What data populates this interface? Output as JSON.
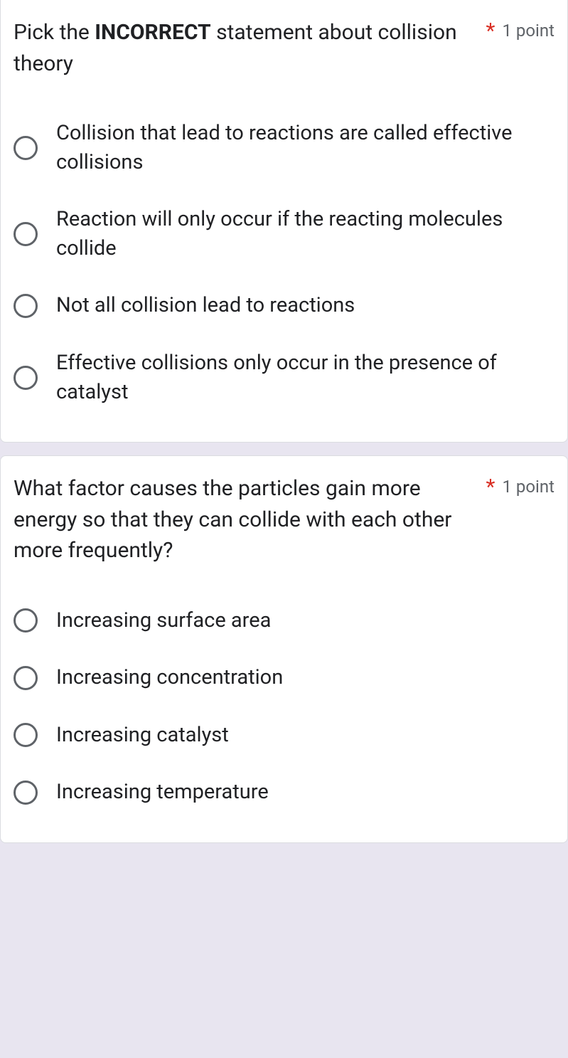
{
  "questions": [
    {
      "title_pre": "Pick the ",
      "title_bold": "INCORRECT",
      "title_post": " statement about collision theory",
      "required_mark": "*",
      "points": "1 point",
      "options": [
        "Collision that lead to reactions are called effective collisions",
        "Reaction will only occur if the reacting molecules collide",
        "Not all collision lead to reactions",
        "Effective collisions only occur in the presence of catalyst"
      ]
    },
    {
      "title_pre": "What factor causes the particles gain more energy so that they can collide with each other more frequently?",
      "title_bold": "",
      "title_post": "",
      "required_mark": "*",
      "points": "1 point",
      "options": [
        "Increasing surface area",
        "Increasing concentration",
        "Increasing catalyst",
        "Increasing temperature"
      ]
    }
  ]
}
